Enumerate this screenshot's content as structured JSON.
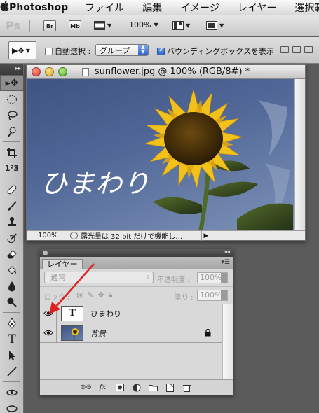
{
  "menubar": {
    "app": "Photoshop",
    "items": [
      "ファイル",
      "編集",
      "イメージ",
      "レイヤー",
      "選択範"
    ]
  },
  "appbar": {
    "logo": "Ps",
    "bridge_btn": "Br",
    "minibridge_btn": "Mb",
    "zoom": "100%"
  },
  "options": {
    "auto_select_label": "自動選択 :",
    "auto_select_checked": false,
    "auto_select_target": "グループ",
    "bounding_box_label": "バウンディングボックスを表示",
    "bounding_box_checked": true
  },
  "document": {
    "title": "sunflower.jpg @ 100% (RGB/8#) *",
    "canvas_text": "ひまわり",
    "status_zoom": "100%",
    "status_info": "露光量は 32 bit だけで機能し…"
  },
  "layers_panel": {
    "tab_label": "レイヤー",
    "blend_mode": "通常",
    "opacity_label": "不透明度 :",
    "opacity_value": "100%",
    "lock_label": "ロック :",
    "fill_label": "塗り :",
    "fill_value": "100%",
    "layers": [
      {
        "name": "ひまわり",
        "kind": "text",
        "thumb": "T",
        "visible": true
      },
      {
        "name": "背景",
        "kind": "image",
        "visible": true,
        "locked": true
      }
    ]
  },
  "colors": {
    "annotation_arrow": "#e02020",
    "sky": "#4f6696",
    "petal": "#f2c21b"
  }
}
